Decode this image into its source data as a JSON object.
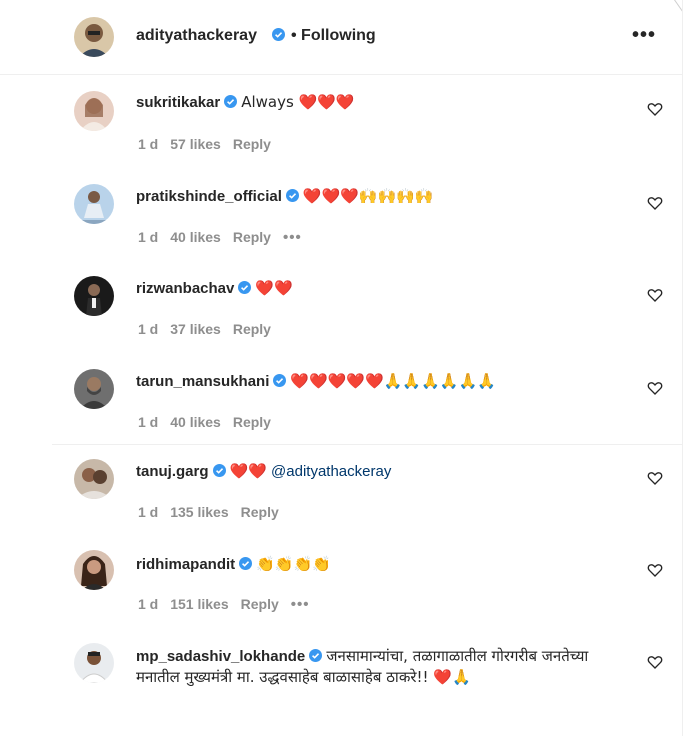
{
  "header": {
    "username": "adityathackeray",
    "status": "• Following",
    "more_label": "•••"
  },
  "comments": [
    {
      "username": "sukritikakar",
      "text": "Always ❤️❤️❤️",
      "time": "1 d",
      "likes": "57 likes",
      "reply": "Reply",
      "more": ""
    },
    {
      "username": "pratikshinde_official",
      "text": "❤️❤️❤️🙌🙌🙌🙌",
      "time": "1 d",
      "likes": "40 likes",
      "reply": "Reply",
      "more": "•••"
    },
    {
      "username": "rizwanbachav",
      "text": "❤️❤️",
      "time": "1 d",
      "likes": "37 likes",
      "reply": "Reply",
      "more": ""
    },
    {
      "username": "tarun_mansukhani",
      "text": "❤️❤️❤️❤️❤️🙏🙏🙏🙏🙏🙏",
      "time": "1 d",
      "likes": "40 likes",
      "reply": "Reply",
      "more": ""
    },
    {
      "username": "tanuj.garg",
      "text": "❤️❤️",
      "mention": "@adityathackeray",
      "time": "1 d",
      "likes": "135 likes",
      "reply": "Reply",
      "more": ""
    },
    {
      "username": "ridhimapandit",
      "text": "👏👏👏👏",
      "time": "1 d",
      "likes": "151 likes",
      "reply": "Reply",
      "more": "•••"
    },
    {
      "username": "mp_sadashiv_lokhande",
      "text": "जनसामान्यांचा, तळागाळातील गोरगरीब जनतेच्या मनातील मुख्यमंत्री मा. उद्धवसाहेब बाळासाहेब ठाकरे!! ❤️🙏"
    }
  ],
  "colors": {
    "verified": "#3897f0",
    "muted": "#8e8e8e",
    "mention": "#00376b"
  }
}
